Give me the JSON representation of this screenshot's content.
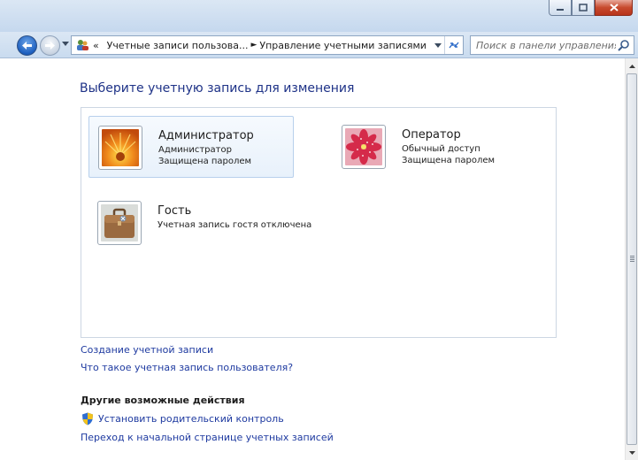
{
  "navigation": {
    "breadcrumb_parent": "Учетные записи пользова...",
    "breadcrumb_prefix": "«",
    "breadcrumb_separator": "►",
    "breadcrumb_current": "Управление учетными записями",
    "search_placeholder": "Поиск в панели управления"
  },
  "main": {
    "heading": "Выберите учетную запись для изменения",
    "accounts": [
      {
        "name": "Администратор",
        "type": "Администратор",
        "status": "Защищена паролем",
        "picture": "orange-flower",
        "selected": true
      },
      {
        "name": "Оператор",
        "type": "Обычный доступ",
        "status": "Защищена паролем",
        "picture": "pink-flower",
        "selected": false
      },
      {
        "name": "Гость",
        "type": "Учетная запись гостя отключена",
        "picture": "briefcase",
        "selected": false
      }
    ],
    "links": {
      "create_account": "Создание учетной записи",
      "what_is_account": "Что такое учетная запись пользователя?"
    },
    "other_actions": {
      "heading": "Другие возможные действия",
      "parental_control": "Установить родительский контроль",
      "go_to_main": "Переход к начальной странице учетных записей"
    }
  },
  "colors": {
    "link": "#1e3aa0",
    "heading": "#1e3287",
    "selection_border": "#b8d0ec",
    "close_button": "#c74a2e"
  }
}
